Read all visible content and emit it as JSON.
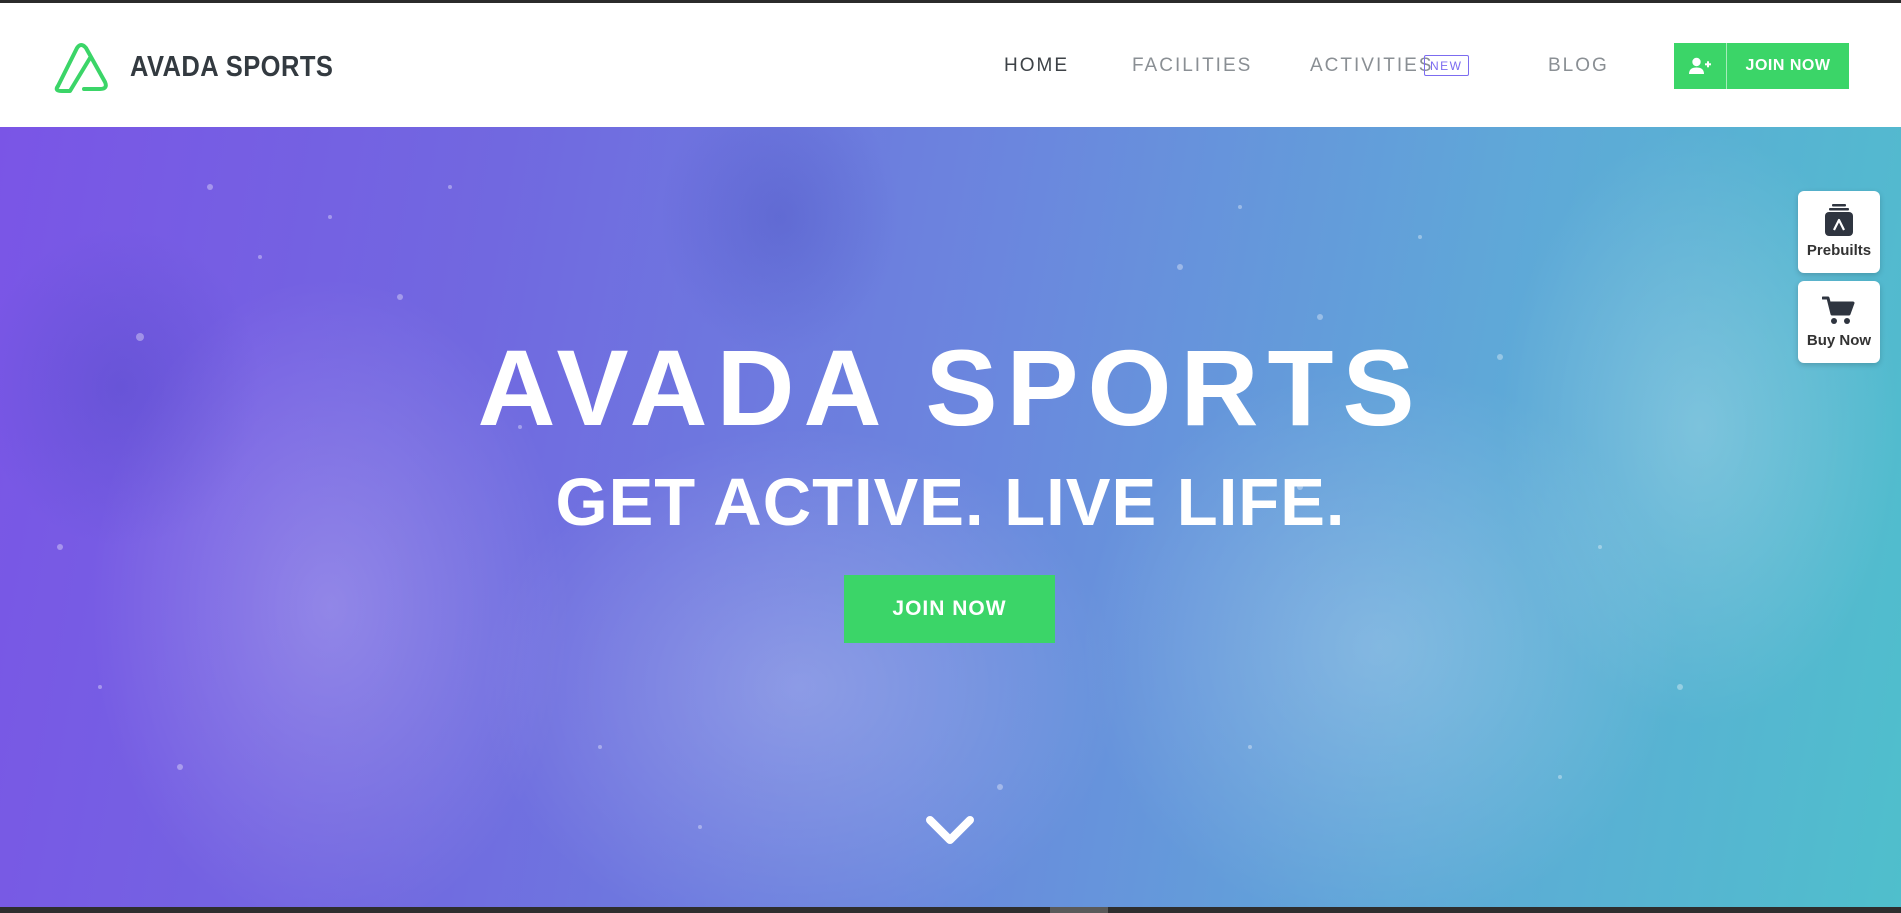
{
  "header": {
    "logo_text": "AVADA SPORTS",
    "nav": [
      {
        "label": "HOME",
        "active": true
      },
      {
        "label": "FACILITIES",
        "active": false
      },
      {
        "label": "ACTIVITIES",
        "active": false,
        "badge": "NEW"
      },
      {
        "label": "BLOG",
        "active": false
      }
    ],
    "join_label": "JOIN NOW"
  },
  "hero": {
    "title": "AVADA SPORTS",
    "subtitle": "GET ACTIVE. LIVE LIFE.",
    "cta_label": "JOIN NOW"
  },
  "side_panel": {
    "prebuilts_label": "Prebuilts",
    "buy_label": "Buy Now"
  },
  "colors": {
    "accent_green": "#3bd568",
    "badge_purple": "#7c6cf0",
    "hero_gradient_start": "#7a55e6",
    "hero_gradient_end": "#4fbfcc"
  },
  "icons": {
    "logo": "avada-logo-icon",
    "join": "user-plus-icon",
    "scroll": "chevron-down-icon",
    "prebuilts": "prebuilts-icon",
    "buy": "cart-icon"
  }
}
